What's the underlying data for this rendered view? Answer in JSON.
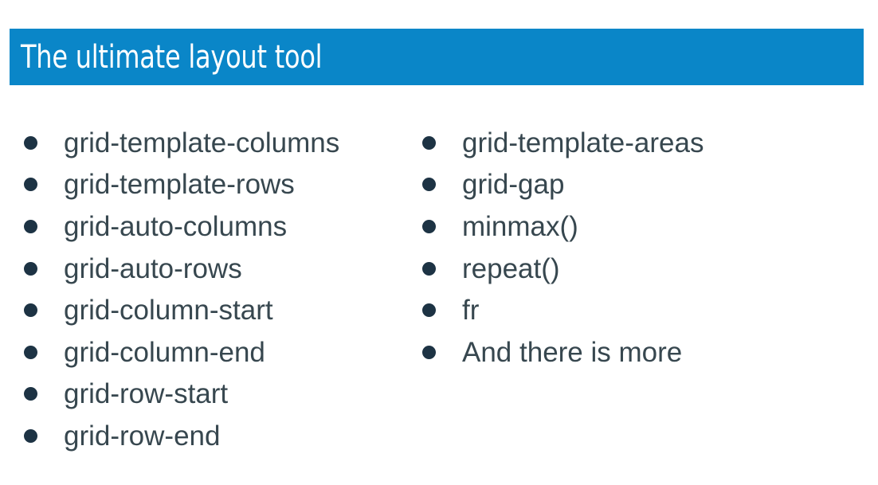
{
  "slide": {
    "title": "The ultimate layout tool",
    "left_column": [
      "grid-template-columns",
      "grid-template-rows",
      "grid-auto-columns",
      "grid-auto-rows",
      "grid-column-start",
      "grid-column-end",
      "grid-row-start",
      "grid-row-end"
    ],
    "right_column": [
      "grid-template-areas",
      "grid-gap",
      "minmax()",
      "repeat()",
      "fr",
      "And there is more"
    ]
  },
  "colors": {
    "title_bar": "#0a86c8",
    "title_text": "#ffffff",
    "bullet": "#1d3344",
    "body_text": "#37474f"
  }
}
